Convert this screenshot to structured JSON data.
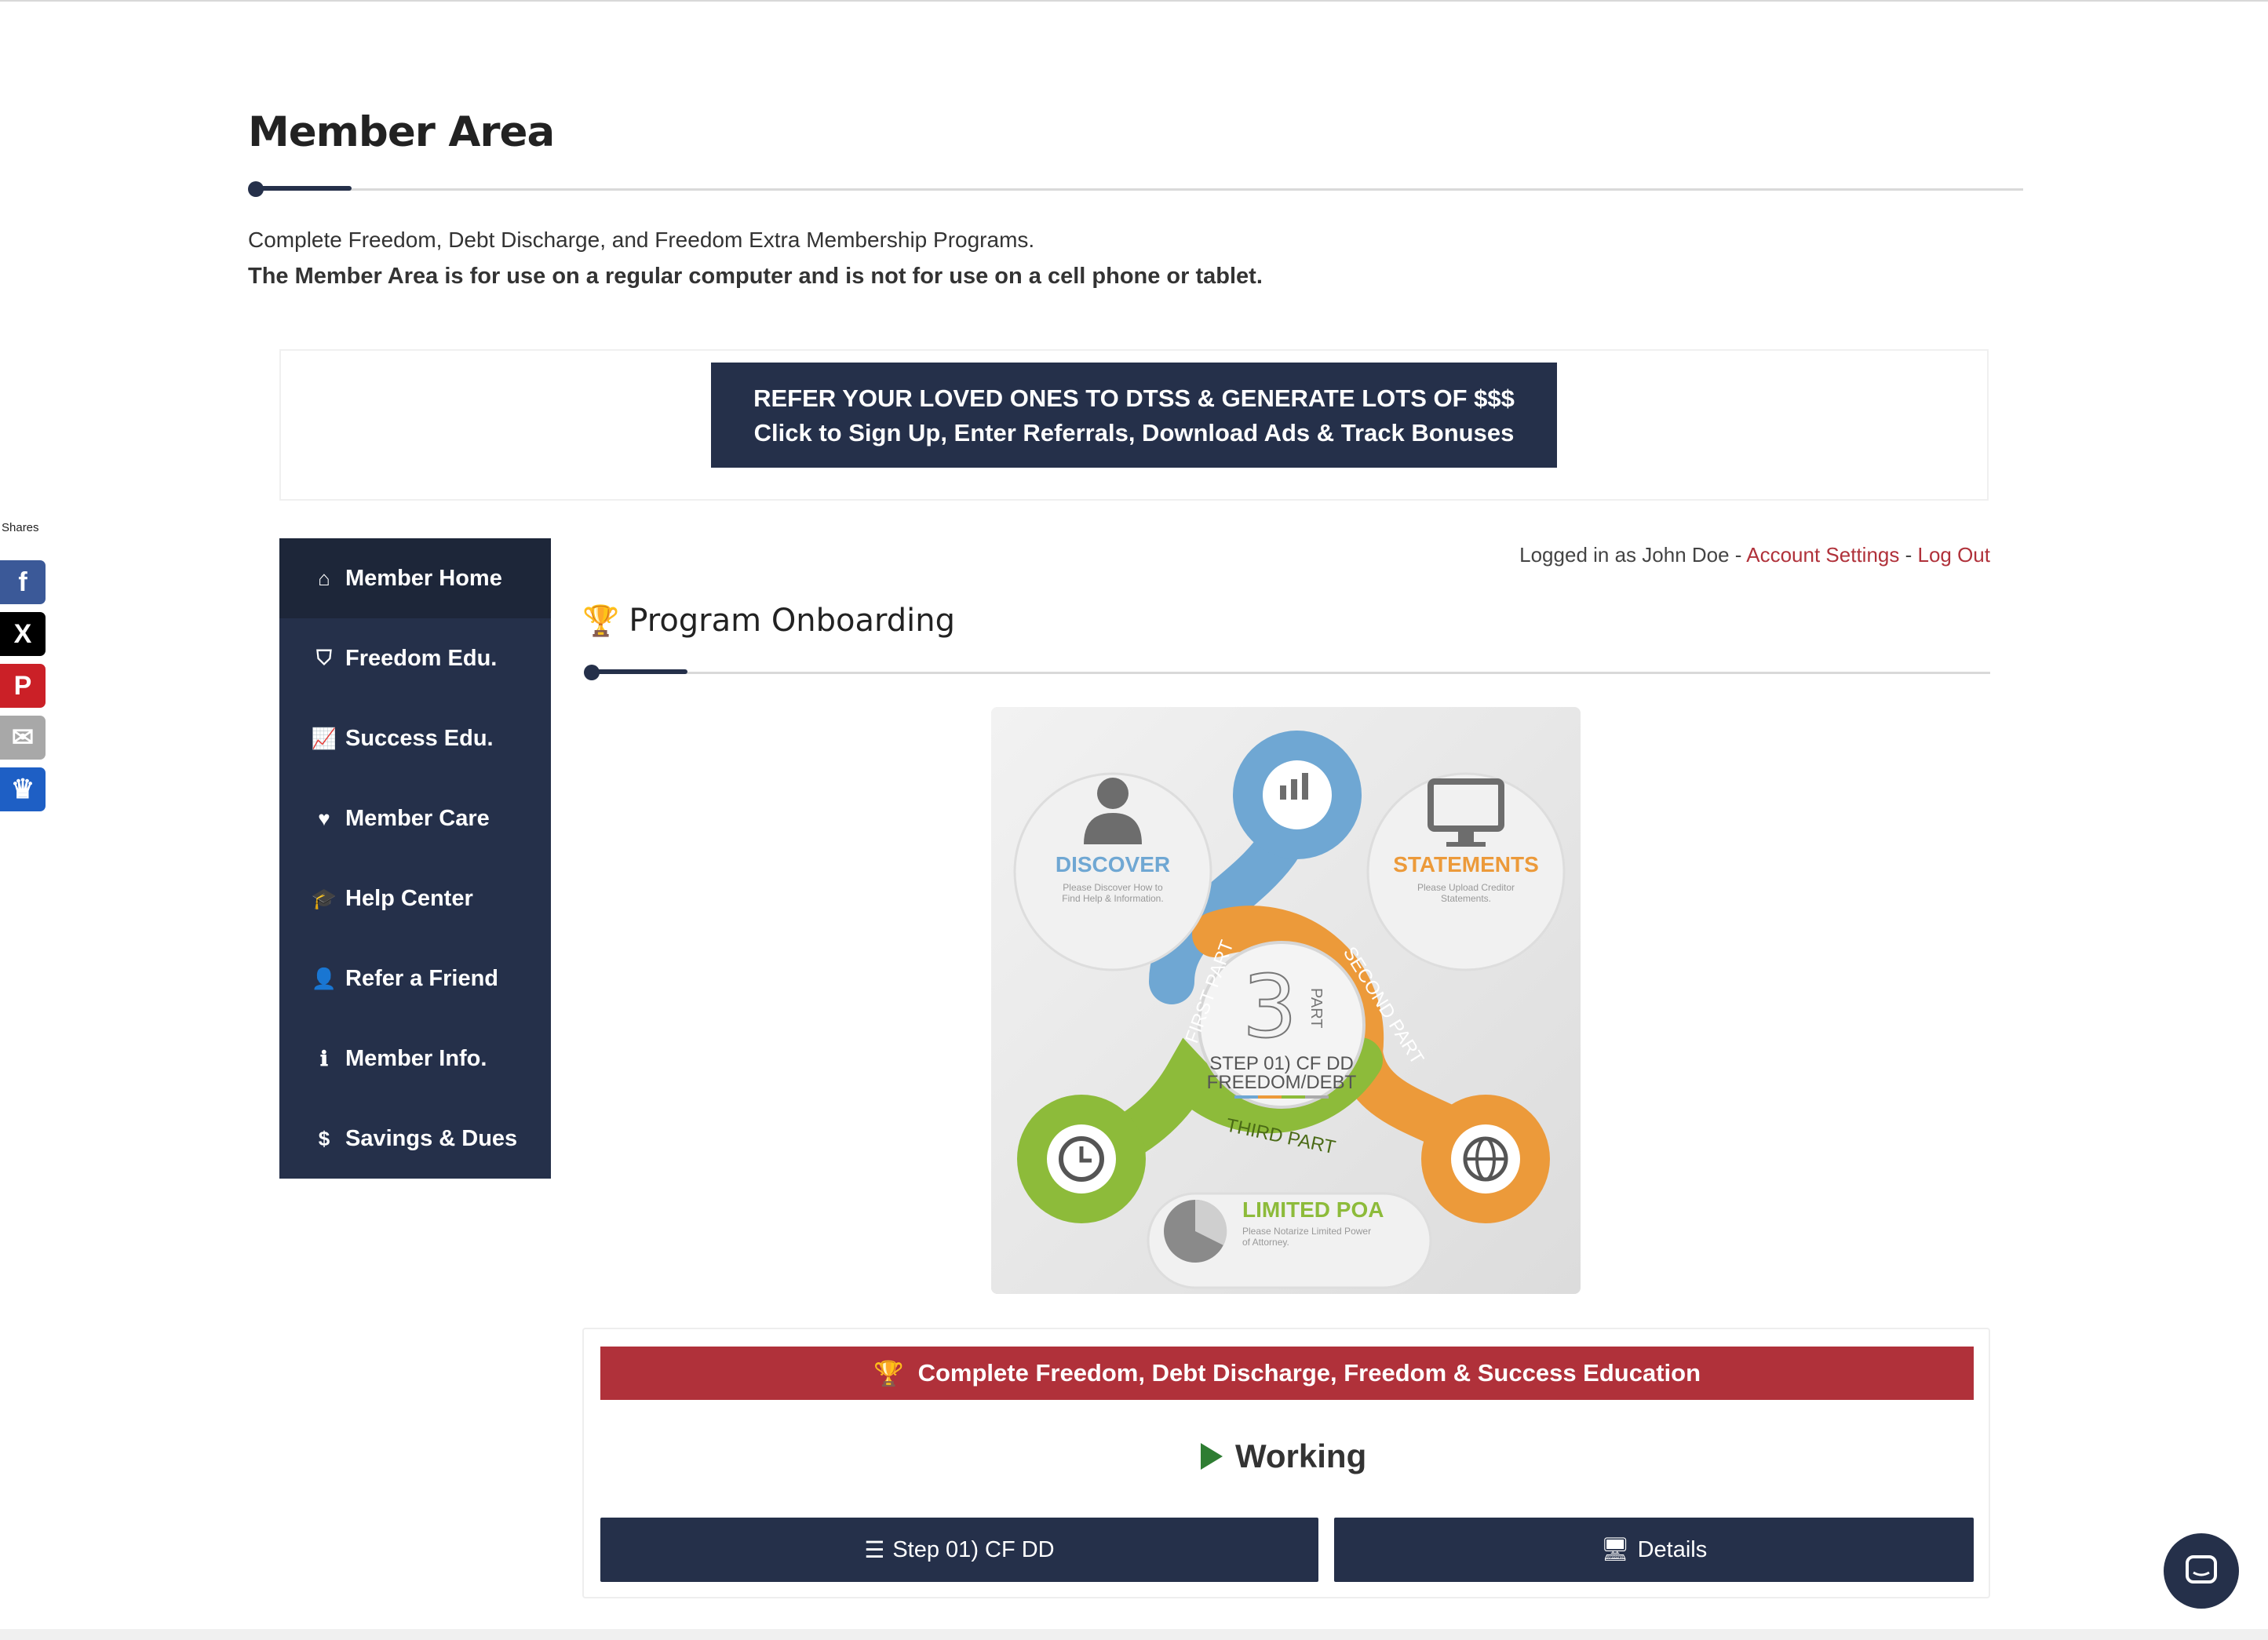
{
  "page": {
    "title": "Member Area",
    "intro": "Complete Freedom, Debt Discharge, and Freedom Extra Membership Programs.",
    "intro_bold": "The Member Area is for use on a regular computer and is not for use on a cell phone or tablet."
  },
  "referral_banner": {
    "line1": "REFER YOUR LOVED ONES TO DTSS & GENERATE LOTS OF $$$",
    "line2": "Click to Sign Up, Enter Referrals, Download Ads & Track Bonuses"
  },
  "shares": {
    "label": "Shares",
    "buttons": [
      {
        "name": "facebook",
        "glyph": "f",
        "color": "#3b5998"
      },
      {
        "name": "x",
        "glyph": "X",
        "color": "#000000"
      },
      {
        "name": "pinterest",
        "glyph": "P",
        "color": "#cb2027"
      },
      {
        "name": "email",
        "glyph": "✉",
        "color": "#a8a8a8"
      },
      {
        "name": "sumo",
        "glyph": "♛",
        "color": "#1e5fc5"
      }
    ]
  },
  "sidebar": {
    "items": [
      {
        "label": "Member Home",
        "icon": "home-icon",
        "glyph": "⌂",
        "active": true
      },
      {
        "label": "Freedom Edu.",
        "icon": "shield-icon",
        "glyph": "⛉",
        "active": false
      },
      {
        "label": "Success Edu.",
        "icon": "line-chart-icon",
        "glyph": "📈",
        "active": false
      },
      {
        "label": "Member Care",
        "icon": "heart-icon",
        "glyph": "♥",
        "active": false
      },
      {
        "label": "Help Center",
        "icon": "graduation-cap-icon",
        "glyph": "🎓",
        "active": false
      },
      {
        "label": "Refer a Friend",
        "icon": "user-icon",
        "glyph": "👤",
        "active": false
      },
      {
        "label": "Member Info.",
        "icon": "info-icon",
        "glyph": "ℹ",
        "active": false
      },
      {
        "label": "Savings & Dues",
        "icon": "dollar-icon",
        "glyph": "$",
        "active": false
      }
    ]
  },
  "session": {
    "logged_in_text": "Logged in as John Doe - ",
    "account_settings": "Account Settings",
    "separator": " - ",
    "logout": "Log Out"
  },
  "section": {
    "title": "Program Onboarding",
    "icon": "trophy-icon"
  },
  "graphic": {
    "discover_title": "DISCOVER",
    "discover_sub1": "Please Discover How to",
    "discover_sub2": "Find Help & Information.",
    "statements_title": "STATEMENTS",
    "statements_sub1": "Please Upload Creditor",
    "statements_sub2": "Statements.",
    "poa_title": "LIMITED POA",
    "poa_sub1": "Please Notarize Limited Power",
    "poa_sub2": "of Attorney.",
    "first_part": "FIRST PART",
    "second_part": "SECOND PART",
    "third_part": "THIRD PART",
    "center_number": "3",
    "center_part": "PART",
    "center_line1": "STEP 01) CF DD",
    "center_line2": "FREEDOM/DEBT",
    "colors": {
      "blue": "#6fa7d3",
      "orange": "#ec9a3a",
      "green": "#8dbb3a"
    }
  },
  "program": {
    "title": "Complete Freedom, Debt Discharge, Freedom & Success Education",
    "status": "Working",
    "step_button": "Step 01) CF DD",
    "details_button": "Details"
  },
  "colors": {
    "navy": "#25304a",
    "red": "#b0313a",
    "green": "#2e7d32"
  }
}
